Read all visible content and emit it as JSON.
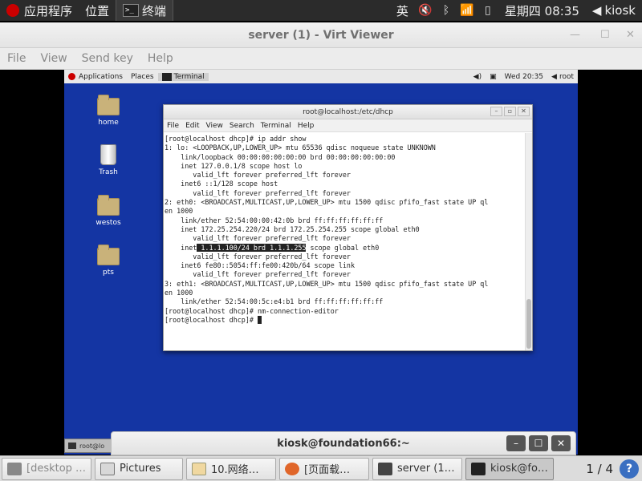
{
  "host_panel": {
    "applications": "应用程序",
    "places": "位置",
    "terminal_task": "终端",
    "input_method": "英",
    "clock": "星期四 08:35",
    "user": "kiosk"
  },
  "viewer": {
    "title": "server (1) - Virt Viewer",
    "menu": [
      "File",
      "View",
      "Send key",
      "Help"
    ]
  },
  "guest": {
    "panel": {
      "applications": "Applications",
      "places": "Places",
      "terminal": "Terminal",
      "clock": "Wed 20:35",
      "user": "root"
    },
    "desktop_icons": [
      "home",
      "Trash",
      "westos",
      "pts"
    ],
    "terminal": {
      "title": "root@localhost:/etc/dhcp",
      "menu": [
        "File",
        "Edit",
        "View",
        "Search",
        "Terminal",
        "Help"
      ],
      "lines": [
        "[root@localhost dhcp]# ip addr show",
        "1: lo: <LOOPBACK,UP,LOWER_UP> mtu 65536 qdisc noqueue state UNKNOWN",
        "    link/loopback 00:00:00:00:00:00 brd 00:00:00:00:00:00",
        "    inet 127.0.0.1/8 scope host lo",
        "       valid_lft forever preferred_lft forever",
        "    inet6 ::1/128 scope host",
        "       valid_lft forever preferred_lft forever",
        "2: eth0: <BROADCAST,MULTICAST,UP,LOWER_UP> mtu 1500 qdisc pfifo_fast state UP ql",
        "en 1000",
        "    link/ether 52:54:00:00:42:0b brd ff:ff:ff:ff:ff:ff",
        "    inet 172.25.254.220/24 brd 172.25.254.255 scope global eth0",
        "       valid_lft forever preferred_lft forever"
      ],
      "highlight_prefix": "    inet",
      "highlight_text": " 1.1.1.100/24 brd 1.1.1.255",
      "highlight_suffix": " scope global eth0",
      "lines2": [
        "       valid_lft forever preferred_lft forever",
        "    inet6 fe80::5054:ff:fe00:420b/64 scope link",
        "       valid_lft forever preferred_lft forever",
        "3: eth1: <BROADCAST,MULTICAST,UP,LOWER_UP> mtu 1500 qdisc pfifo_fast state UP ql",
        "en 1000",
        "    link/ether 52:54:00:5c:e4:b1 brd ff:ff:ff:ff:ff:ff",
        "[root@localhost dhcp]# nm-connection-editor",
        "[root@localhost dhcp]# "
      ]
    },
    "taskbar_item": "root@lo"
  },
  "kiosk_window": {
    "title": "kiosk@foundation66:~"
  },
  "host_taskbar": {
    "items": [
      "[desktop …",
      "Pictures",
      "10.网络…",
      "[页面载…",
      "server (1…",
      "kiosk@fo…"
    ],
    "pager": "1 / 4",
    "help": "?"
  }
}
